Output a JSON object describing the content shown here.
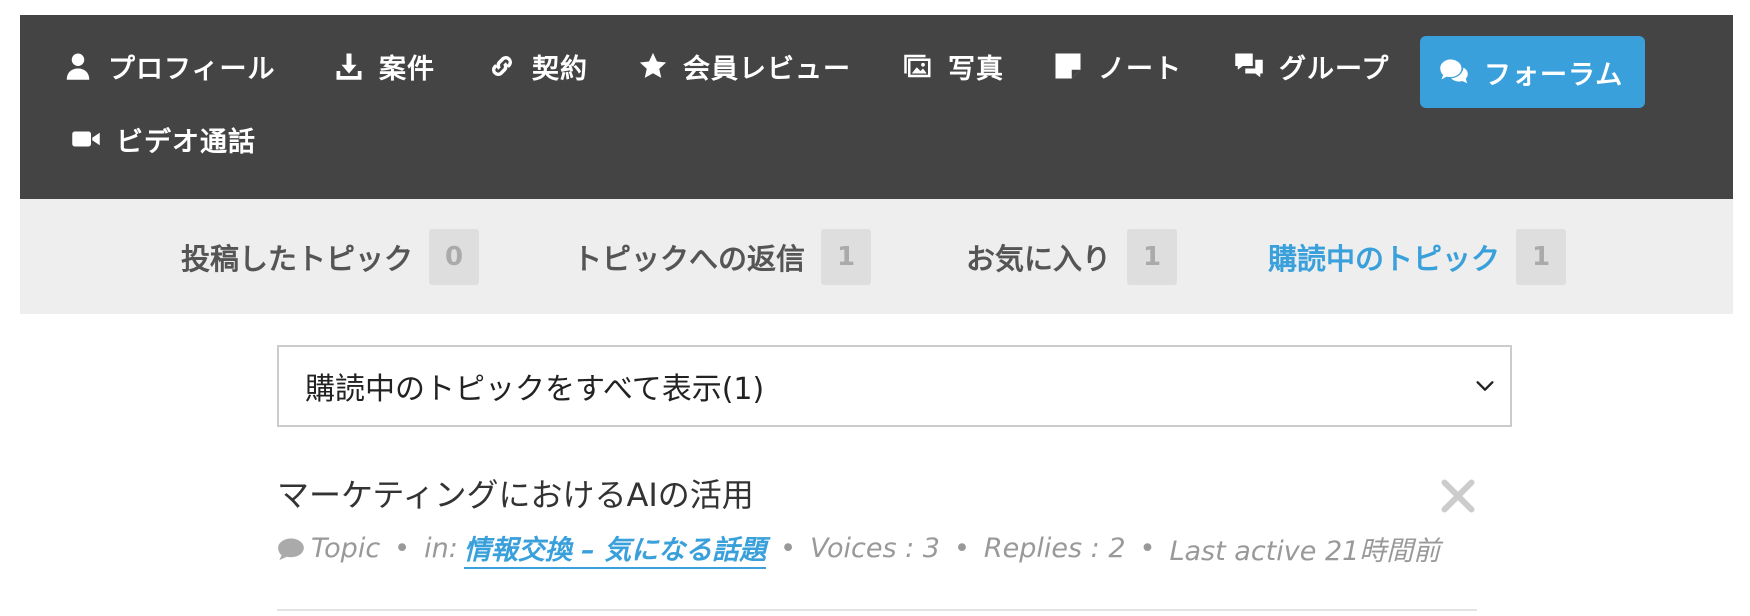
{
  "nav": {
    "items": [
      {
        "label": "プロフィール",
        "icon": "user-icon"
      },
      {
        "label": "案件",
        "icon": "download-icon"
      },
      {
        "label": "契約",
        "icon": "link-icon"
      },
      {
        "label": "会員レビュー",
        "icon": "star-icon"
      },
      {
        "label": "写真",
        "icon": "image-icon"
      },
      {
        "label": "ノート",
        "icon": "note-icon"
      },
      {
        "label": "グループ",
        "icon": "chat-bubbles-icon"
      },
      {
        "label": "フォーラム",
        "icon": "comments-icon",
        "active": true
      },
      {
        "label": "ビデオ通話",
        "icon": "video-icon"
      }
    ]
  },
  "subnav": {
    "items": [
      {
        "label": "投稿したトピック",
        "count": "0"
      },
      {
        "label": "トピックへの返信",
        "count": "1"
      },
      {
        "label": "お気に入り",
        "count": "1"
      },
      {
        "label": "購読中のトピック",
        "count": "1",
        "active": true
      }
    ]
  },
  "filter": {
    "selected": "購読中のトピックをすべて表示(1)"
  },
  "topic": {
    "title": "マーケティングにおけるAIの活用",
    "type": "Topic",
    "in_label": "in:",
    "forum": "情報交換 – 気になる話題",
    "voices": "Voices : 3",
    "replies": "Replies : 2",
    "last_active": "Last active 21時間前"
  },
  "colors": {
    "accent": "#3aa0db",
    "nav_bg": "#444444",
    "subnav_bg": "#eeeeee"
  }
}
